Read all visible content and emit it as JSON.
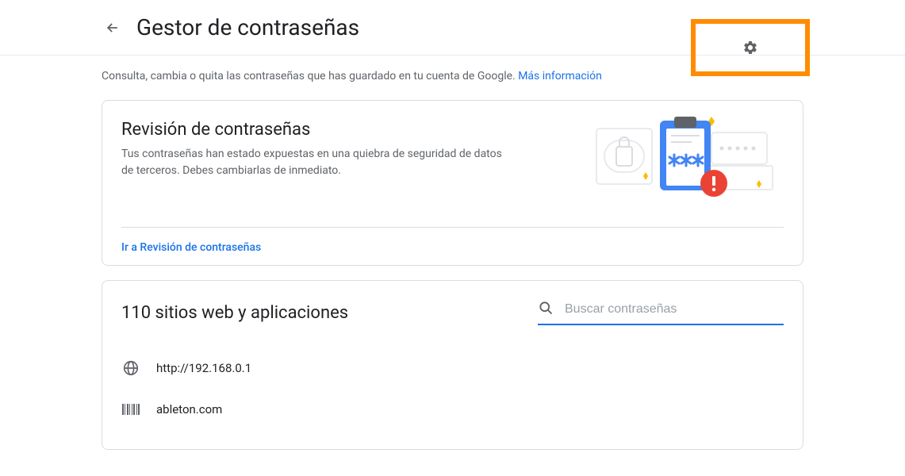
{
  "header": {
    "title": "Gestor de contraseñas"
  },
  "subtitle": {
    "text": "Consulta, cambia o quita las contraseñas que has guardado en tu cuenta de Google. ",
    "link": "Más información"
  },
  "checkup": {
    "title": "Revisión de contraseñas",
    "description": "Tus contraseñas han estado expuestas en una quiebra de seguridad de datos de terceros. Debes cambiarlas de inmediato.",
    "link_label": "Ir a Revisión de contraseñas"
  },
  "sites": {
    "title": "110 sitios web y aplicaciones",
    "search_placeholder": "Buscar contraseñas",
    "items": [
      {
        "name": "http://192.168.0.1",
        "icon": "globe"
      },
      {
        "name": "ableton.com",
        "icon": "barcode"
      }
    ]
  }
}
